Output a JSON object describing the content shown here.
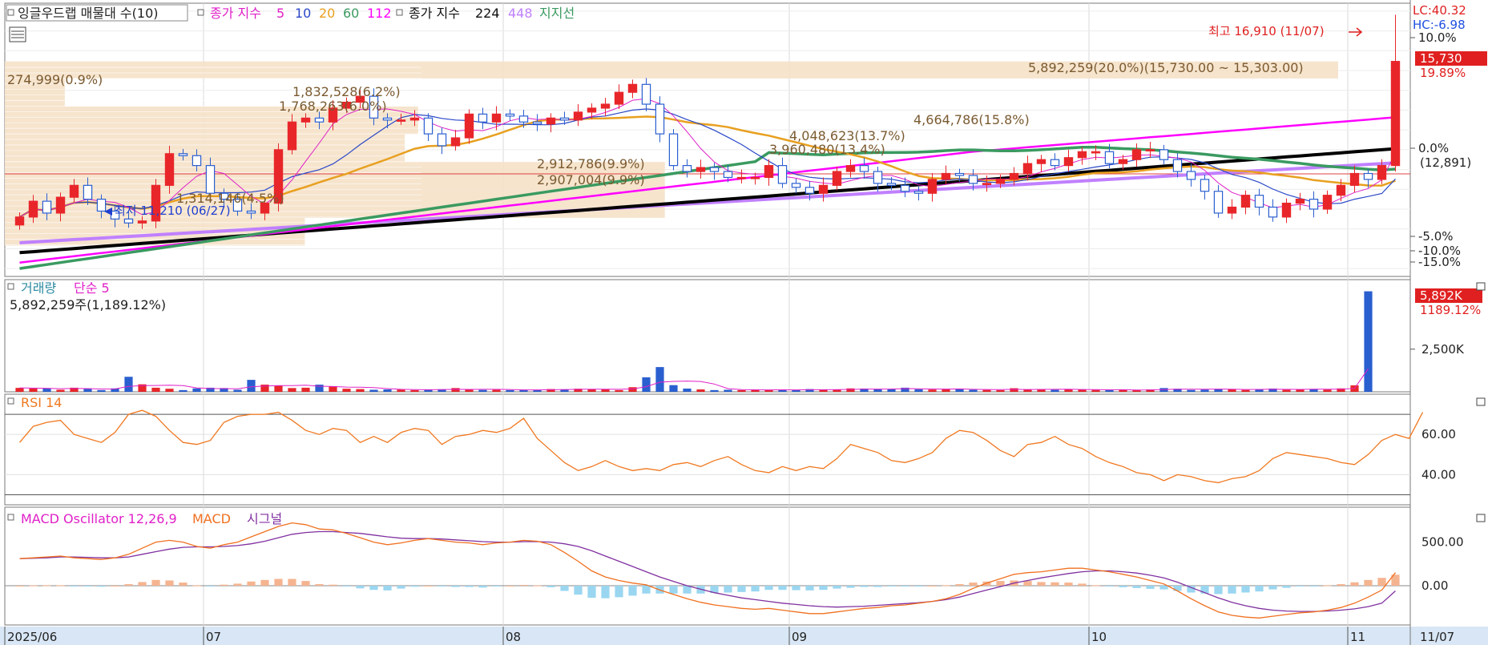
{
  "header": {
    "title_box": "잉글우드랩 매물대 수(10)",
    "close_label": "종가 지수",
    "ma5": "5",
    "ma10": "10",
    "ma20": "20",
    "ma60": "60",
    "ma112": "112",
    "close_label2": "종가 지수",
    "ma224": "224",
    "ma448": "448",
    "support": "지지선"
  },
  "price_panel": {
    "lc_label": "LC:40.32",
    "hc_label": "HC:-6.98",
    "current_price": "15,730",
    "current_change": "19.89%",
    "base_price": "(12,891)",
    "y_labels": [
      "10.0%",
      "0.0%",
      "-5.0%",
      "-10.0%",
      "-15.0%"
    ],
    "high_annotation": "최고 16,910 (11/07)",
    "low_annotation": "최저 11,210 (06/27)",
    "volume_profile_labels": [
      "274,999(0.9%)",
      "1,832,528(6.2%)",
      "1,768,263(6.0%)",
      "5,892,259(20.0%)(15,730.00 ~ 15,303.00)",
      "2,912,786(9.9%)",
      "2,907,004(9.9%)",
      "4,048,623(13.7%)",
      "3,960,480(13.4%)",
      "4,664,786(15.8%)",
      "1,314,146(4.5%)"
    ]
  },
  "volume_panel": {
    "title": "거래량",
    "ma_label": "단순 5",
    "info": "5,892,259주(1,189.12%)",
    "current_value": "5,892K",
    "current_pct": "1189.12%",
    "y_label": "2,500K"
  },
  "rsi_panel": {
    "title": "RSI 14",
    "y_labels": [
      "60.00",
      "40.00"
    ]
  },
  "macd_panel": {
    "title": "MACD Oscillator 12,26,9",
    "macd_label": "MACD",
    "signal_label": "시그널",
    "y_labels": [
      "500.00",
      "0.00"
    ]
  },
  "x_axis": {
    "labels": [
      "2025/06",
      "07",
      "08",
      "09",
      "10",
      "11"
    ],
    "right_label": "11/07"
  },
  "colors": {
    "up": "#e8262a",
    "down": "#2a5fd0",
    "ma5": "#e020c8",
    "ma10": "#2a48c8",
    "ma20": "#e8a020",
    "ma60": "#3a9a60",
    "ma112": "#ff00ff",
    "ma224": "#000000",
    "ma448": "#c080ff",
    "profile": "#f5e1c8",
    "rsi": "#f07820",
    "macd": "#f07020",
    "signal": "#8030a0",
    "osc_pos": "#f5b490",
    "osc_neg": "#9ad6f0"
  },
  "chart_data": {
    "type": "candlestick",
    "dates": [
      "06/11",
      "06/12",
      "06/13",
      "06/16",
      "06/17",
      "06/18",
      "06/19",
      "06/20",
      "06/23",
      "06/24",
      "06/25",
      "06/26",
      "06/27",
      "06/30",
      "07/01",
      "07/02",
      "07/03",
      "07/04",
      "07/07",
      "07/08",
      "07/09",
      "07/10",
      "07/11",
      "07/14",
      "07/15",
      "07/16",
      "07/17",
      "07/18",
      "07/21",
      "07/22",
      "07/23",
      "07/24",
      "07/25",
      "07/28",
      "07/29",
      "07/30",
      "07/31",
      "08/01",
      "08/04",
      "08/05",
      "08/06",
      "08/07",
      "08/08",
      "08/11",
      "08/12",
      "08/13",
      "08/14",
      "08/18",
      "08/19",
      "08/20",
      "08/21",
      "08/22",
      "08/25",
      "08/26",
      "08/27",
      "08/28",
      "08/29",
      "09/01",
      "09/02",
      "09/03",
      "09/04",
      "09/05",
      "09/08",
      "09/09",
      "09/10",
      "09/11",
      "09/12",
      "09/15",
      "09/16",
      "09/17",
      "09/18",
      "09/19",
      "09/22",
      "09/23",
      "09/24",
      "09/25",
      "09/26",
      "09/29",
      "09/30",
      "10/01",
      "10/02",
      "10/10",
      "10/13",
      "10/14",
      "10/15",
      "10/16",
      "10/17",
      "10/20",
      "10/21",
      "10/22",
      "10/23",
      "10/24",
      "10/27",
      "10/28",
      "10/29",
      "10/30",
      "10/31",
      "11/03",
      "11/04",
      "11/05",
      "11/06",
      "11/07"
    ],
    "close": [
      11800,
      12200,
      11900,
      12300,
      12600,
      12250,
      11950,
      11750,
      11650,
      11700,
      12600,
      13400,
      13350,
      13100,
      12400,
      12250,
      11950,
      11900,
      12150,
      13500,
      14200,
      14300,
      14200,
      14550,
      14700,
      14850,
      14300,
      14250,
      14250,
      14300,
      13900,
      13600,
      13800,
      14400,
      14200,
      14400,
      14350,
      14200,
      14150,
      14300,
      14250,
      14450,
      14550,
      14650,
      14950,
      15150,
      14650,
      13900,
      13100,
      12950,
      13050,
      12950,
      12800,
      12800,
      12800,
      13100,
      12650,
      12550,
      12400,
      12600,
      12950,
      13100,
      12950,
      12650,
      12600,
      12450,
      12400,
      12750,
      12900,
      12850,
      12650,
      12650,
      12750,
      12900,
      13150,
      13250,
      13100,
      13300,
      13450,
      13450,
      13150,
      13250,
      13500,
      13500,
      13250,
      12950,
      12750,
      12450,
      11900,
      12050,
      12350,
      12050,
      11800,
      12150,
      12250,
      12000,
      12350,
      12600,
      12900,
      12750,
      13100,
      15730
    ],
    "volume_k": [
      230,
      200,
      190,
      120,
      240,
      180,
      100,
      200,
      880,
      440,
      240,
      180,
      100,
      200,
      240,
      220,
      120,
      700,
      420,
      350,
      220,
      240,
      420,
      330,
      180,
      160,
      120,
      140,
      130,
      100,
      120,
      150,
      220,
      120,
      110,
      120,
      100,
      120,
      110,
      160,
      150,
      180,
      140,
      150,
      100,
      270,
      850,
      1450,
      390,
      190,
      140,
      100,
      120,
      100,
      130,
      110,
      120,
      100,
      160,
      120,
      130,
      200,
      190,
      160,
      150,
      240,
      150,
      130,
      140,
      180,
      120,
      110,
      100,
      210,
      140,
      150,
      120,
      150,
      120,
      110,
      100,
      120,
      100,
      140,
      220,
      180,
      110,
      130,
      170,
      160,
      110,
      140,
      190,
      120,
      140,
      170,
      130,
      200,
      380,
      5892
    ],
    "rsi": [
      56,
      64,
      66,
      67,
      60,
      58,
      56,
      61,
      70,
      72,
      69,
      62,
      56,
      55,
      57,
      66,
      69,
      70,
      70,
      71,
      67,
      62,
      60,
      63,
      62,
      56,
      59,
      56,
      61,
      63,
      62,
      55,
      59,
      60,
      62,
      61,
      63,
      68,
      58,
      52,
      46,
      42,
      44,
      47,
      44,
      42,
      43,
      42,
      45,
      46,
      44,
      47,
      49,
      45,
      42,
      41,
      44,
      42,
      44,
      43,
      48,
      55,
      53,
      51,
      47,
      46,
      48,
      51,
      58,
      62,
      61,
      57,
      52,
      49,
      55,
      56,
      59,
      55,
      53,
      49,
      46,
      44,
      41,
      40,
      37,
      40,
      39,
      37,
      36,
      38,
      39,
      42,
      48,
      51,
      50,
      49,
      48,
      46,
      45,
      50,
      57,
      60,
      58,
      71
    ],
    "macd": [
      310,
      320,
      330,
      340,
      320,
      310,
      300,
      320,
      360,
      430,
      500,
      520,
      500,
      450,
      430,
      470,
      500,
      560,
      620,
      680,
      720,
      700,
      650,
      640,
      600,
      550,
      500,
      470,
      490,
      520,
      540,
      520,
      500,
      490,
      470,
      490,
      500,
      520,
      510,
      470,
      380,
      280,
      170,
      100,
      60,
      30,
      10,
      -50,
      -100,
      -150,
      -190,
      -220,
      -240,
      -260,
      -270,
      -260,
      -280,
      -300,
      -320,
      -320,
      -300,
      -280,
      -260,
      -250,
      -230,
      -220,
      -200,
      -180,
      -150,
      -100,
      -30,
      30,
      80,
      130,
      150,
      160,
      180,
      200,
      200,
      180,
      160,
      130,
      100,
      60,
      20,
      -60,
      -150,
      -230,
      -300,
      -340,
      -360,
      -370,
      -350,
      -330,
      -310,
      -300,
      -280,
      -250,
      -200,
      -130,
      -50,
      150
    ],
    "signal": [
      310,
      315,
      320,
      330,
      330,
      325,
      320,
      320,
      330,
      360,
      390,
      420,
      440,
      445,
      445,
      450,
      460,
      480,
      510,
      550,
      590,
      610,
      620,
      620,
      610,
      600,
      580,
      560,
      545,
      540,
      540,
      535,
      525,
      515,
      505,
      500,
      500,
      505,
      505,
      500,
      480,
      450,
      400,
      340,
      280,
      220,
      160,
      100,
      50,
      0,
      -40,
      -80,
      -110,
      -140,
      -160,
      -180,
      -200,
      -215,
      -230,
      -240,
      -245,
      -240,
      -235,
      -225,
      -215,
      -205,
      -195,
      -180,
      -160,
      -130,
      -90,
      -50,
      -10,
      30,
      60,
      90,
      115,
      140,
      160,
      170,
      170,
      160,
      145,
      120,
      90,
      40,
      -20,
      -80,
      -140,
      -190,
      -230,
      -260,
      -280,
      -290,
      -295,
      -295,
      -290,
      -280,
      -265,
      -240,
      -200,
      -60
    ],
    "annotations": {
      "high": 16910,
      "high_date": "11/07",
      "low": 11210,
      "low_date": "06/27"
    }
  }
}
